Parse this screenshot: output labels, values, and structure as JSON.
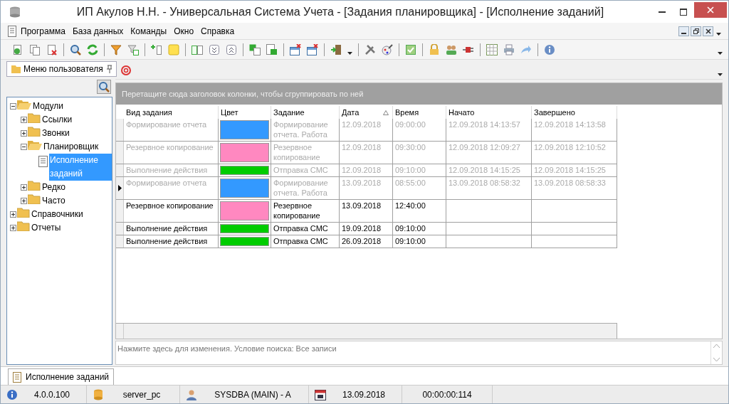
{
  "window": {
    "title": "ИП Акулов Н.Н. - Универсальная Система Учета - [Задания планировщика] - [Исполнение заданий]"
  },
  "menu": [
    "Программа",
    "База данных",
    "Команды",
    "Окно",
    "Справка"
  ],
  "sidebar": {
    "title": "Меню пользователя",
    "tree": [
      {
        "label": "Модули",
        "expanded": true,
        "selected": false,
        "children": [
          {
            "label": "Ссылки",
            "expanded": false,
            "selected": false
          },
          {
            "label": "Звонки",
            "expanded": false,
            "selected": false
          },
          {
            "label": "Планировщик",
            "expanded": true,
            "selected": false,
            "children": [
              {
                "label": "Исполнение заданий",
                "kind": "document",
                "selected": true
              }
            ]
          },
          {
            "label": "Редко",
            "expanded": false,
            "selected": false
          },
          {
            "label": "Часто",
            "expanded": false,
            "selected": false
          }
        ]
      },
      {
        "label": "Справочники",
        "expanded": false,
        "selected": false
      },
      {
        "label": "Отчеты",
        "expanded": false,
        "selected": false
      }
    ]
  },
  "grid": {
    "group_hint": "Перетащите сюда заголовок колонки, чтобы сгруппировать по ней",
    "columns": [
      {
        "label": "Вид задания"
      },
      {
        "label": "Цвет"
      },
      {
        "label": "Задание"
      },
      {
        "label": "Дата",
        "sorted": true
      },
      {
        "label": "Время"
      },
      {
        "label": "Начато"
      },
      {
        "label": "Завершено"
      }
    ],
    "rows": [
      {
        "kind_name": "Формирование отчета",
        "color": "#3399ff",
        "task": "Формирование отчета. Работа",
        "date": "12.09.2018",
        "time": "09:00:00",
        "started": "12.09.2018 14:13:57",
        "finished": "12.09.2018 14:13:58",
        "done": true,
        "selected": false
      },
      {
        "kind_name": "Резервное копирование",
        "color": "#ff88c0",
        "task": "Резервное копирование",
        "date": "12.09.2018",
        "time": "09:30:00",
        "started": "12.09.2018 12:09:27",
        "finished": "12.09.2018 12:10:52",
        "done": true,
        "selected": false
      },
      {
        "kind_name": "Выполнение действия",
        "color": "#00cc00",
        "task": "Отправка СМС",
        "date": "12.09.2018",
        "time": "09:10:00",
        "started": "12.09.2018 14:15:25",
        "finished": "12.09.2018 14:15:25",
        "done": true,
        "selected": false
      },
      {
        "kind_name": "Формирование отчета",
        "color": "#3399ff",
        "task": "Формирование отчета. Работа",
        "date": "13.09.2018",
        "time": "08:55:00",
        "started": "13.09.2018 08:58:32",
        "finished": "13.09.2018 08:58:33",
        "done": true,
        "selected": true
      },
      {
        "kind_name": "Резервное копирование",
        "color": "#ff88c0",
        "task": "Резервное копирование",
        "date": "13.09.2018",
        "time": "12:40:00",
        "done": false,
        "selected": false
      },
      {
        "kind_name": "Выполнение действия",
        "color": "#00cc00",
        "task": "Отправка СМС",
        "date": "19.09.2018",
        "time": "09:10:00",
        "done": false,
        "selected": false
      },
      {
        "kind_name": "Выполнение действия",
        "color": "#00cc00",
        "task": "Отправка СМС",
        "date": "26.09.2018",
        "time": "09:10:00",
        "done": false,
        "selected": false
      }
    ],
    "filter_hint": "Нажмите здесь для изменения. Условие поиска: Все записи"
  },
  "document_tab": {
    "label": "Исполнение заданий"
  },
  "status_bar": [
    {
      "kind": "version",
      "text": "4.0.0.100"
    },
    {
      "kind": "server",
      "text": "server_pc"
    },
    {
      "kind": "user",
      "text": "SYSDBA (MAIN) - A"
    },
    {
      "kind": "date",
      "text": "13.09.2018"
    },
    {
      "kind": "timer",
      "text": "00:00:00:114"
    }
  ]
}
